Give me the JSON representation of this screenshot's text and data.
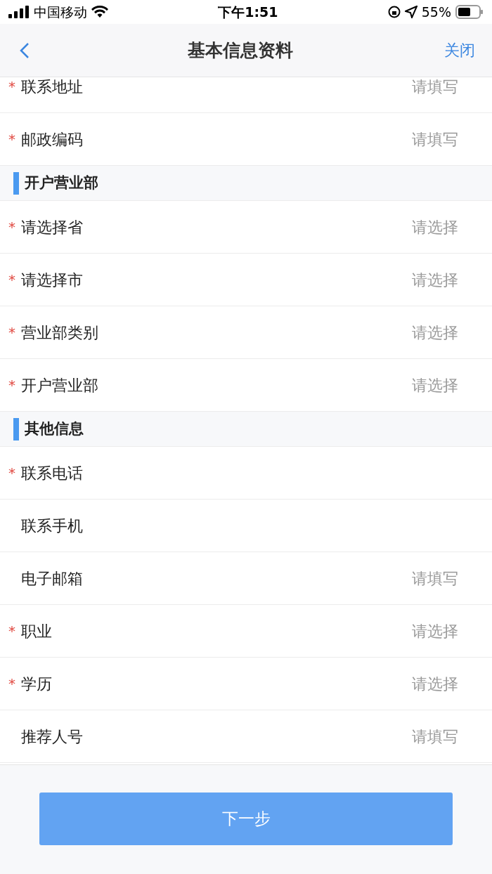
{
  "status_bar": {
    "carrier": "中国移动",
    "time": "下午1:51",
    "battery": "55%"
  },
  "nav": {
    "title": "基本信息资料",
    "close": "关闭"
  },
  "rows": [
    {
      "kind": "field",
      "label": "联系地址",
      "marker": "*",
      "placeholder": "请填写"
    },
    {
      "kind": "field",
      "label": "邮政编码",
      "marker": "*",
      "placeholder": "请填写"
    },
    {
      "kind": "section",
      "label": "开户营业部"
    },
    {
      "kind": "field",
      "label": "请选择省",
      "marker": "*",
      "placeholder": "请选择"
    },
    {
      "kind": "field",
      "label": "请选择市",
      "marker": "*",
      "placeholder": "请选择"
    },
    {
      "kind": "field",
      "label": "营业部类别",
      "marker": "*",
      "placeholder": "请选择"
    },
    {
      "kind": "field",
      "label": "开户营业部",
      "marker": "*",
      "placeholder": "请选择"
    },
    {
      "kind": "section",
      "label": "其他信息"
    },
    {
      "kind": "field",
      "label": "联系电话",
      "marker": "*"
    },
    {
      "kind": "field",
      "label": "联系手机"
    },
    {
      "kind": "field",
      "label": "电子邮箱",
      "placeholder": "请填写"
    },
    {
      "kind": "field",
      "label": "职业",
      "marker": "*",
      "placeholder": "请选择"
    },
    {
      "kind": "field",
      "label": "学历",
      "marker": "*",
      "placeholder": "请选择"
    },
    {
      "kind": "field",
      "label": "推荐人号",
      "placeholder": "请填写"
    }
  ],
  "next_button": "下一步"
}
